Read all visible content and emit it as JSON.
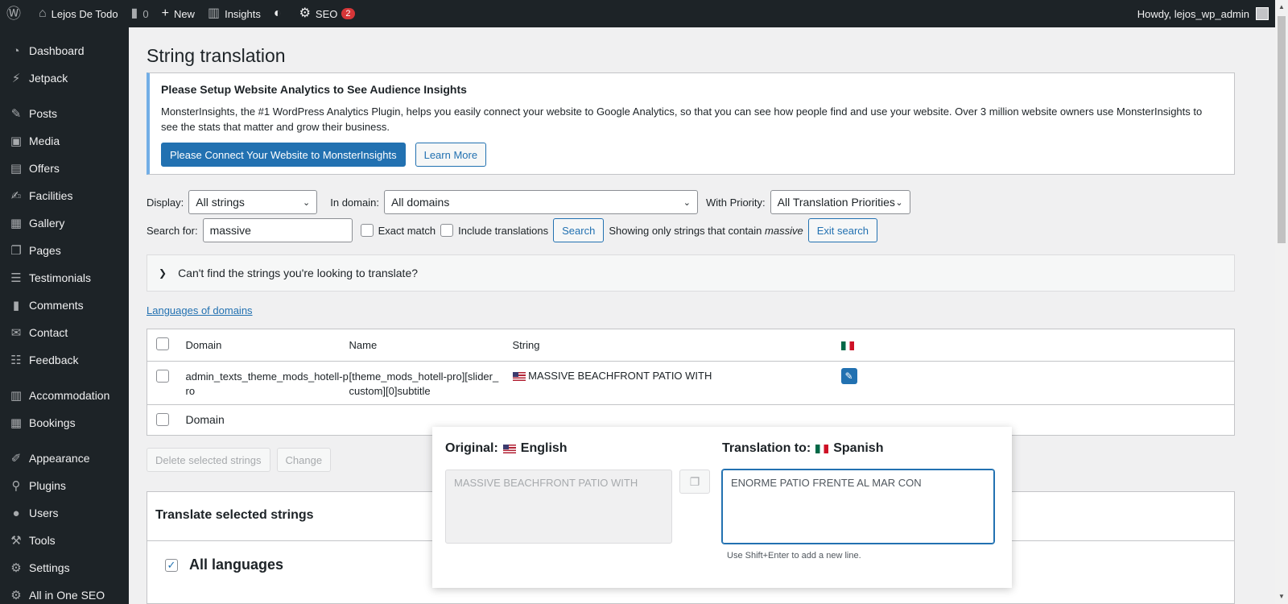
{
  "adminbar": {
    "site_name": "Lejos De Todo",
    "comments_count": "0",
    "new_label": "New",
    "insights_label": "Insights",
    "seo_label": "SEO",
    "seo_badge": "2",
    "howdy": "Howdy, lejos_wp_admin"
  },
  "sidebar": {
    "items": [
      {
        "label": "Dashboard",
        "icon": "dashboard-icon"
      },
      {
        "label": "Jetpack",
        "icon": "jetpack-icon"
      },
      {
        "label": "Posts",
        "icon": "pin-icon"
      },
      {
        "label": "Media",
        "icon": "media-icon"
      },
      {
        "label": "Offers",
        "icon": "briefcase-icon"
      },
      {
        "label": "Facilities",
        "icon": "edit-page-icon"
      },
      {
        "label": "Gallery",
        "icon": "gallery-icon"
      },
      {
        "label": "Pages",
        "icon": "pages-icon"
      },
      {
        "label": "Testimonials",
        "icon": "testimonial-icon"
      },
      {
        "label": "Comments",
        "icon": "comment-icon"
      },
      {
        "label": "Contact",
        "icon": "mail-icon"
      },
      {
        "label": "Feedback",
        "icon": "feedback-icon"
      },
      {
        "label": "Accommodation",
        "icon": "building-icon"
      },
      {
        "label": "Bookings",
        "icon": "calendar-icon"
      },
      {
        "label": "Appearance",
        "icon": "brush-icon"
      },
      {
        "label": "Plugins",
        "icon": "plugin-icon"
      },
      {
        "label": "Users",
        "icon": "user-icon"
      },
      {
        "label": "Tools",
        "icon": "wrench-icon"
      },
      {
        "label": "Settings",
        "icon": "settings-icon"
      },
      {
        "label": "All in One SEO",
        "icon": "seo-icon"
      }
    ]
  },
  "page": {
    "title": "String translation"
  },
  "notice": {
    "title": "Please Setup Website Analytics to See Audience Insights",
    "text": "MonsterInsights, the #1 WordPress Analytics Plugin, helps you easily connect your website to Google Analytics, so that you can see how people find and use your website. Over 3 million website owners use MonsterInsights to see the stats that matter and grow their business.",
    "connect_button": "Please Connect Your Website to MonsterInsights",
    "learn_button": "Learn More"
  },
  "filters": {
    "display_label": "Display:",
    "display_value": "All strings",
    "domain_label": "In domain:",
    "domain_value": "All domains",
    "priority_label": "With Priority:",
    "priority_value": "All Translation Priorities",
    "search_label": "Search for:",
    "search_value": "massive",
    "exact_match": "Exact match",
    "include_translations": "Include translations",
    "search_button": "Search",
    "showing_prefix": "Showing only strings that contain",
    "showing_term": "massive",
    "exit_button": "Exit search"
  },
  "accordion": {
    "label": "Can't find the strings you're looking to translate?"
  },
  "languages_link": "Languages of domains",
  "table": {
    "headers": {
      "domain": "Domain",
      "name": "Name",
      "string": "String"
    },
    "rows": [
      {
        "domain": "admin_texts_theme_mods_hotell-pro",
        "name": "[theme_mods_hotell-pro][slider_custom][0]subtitle",
        "string": "MASSIVE BEACHFRONT PATIO WITH"
      }
    ],
    "footer_domain": "Domain"
  },
  "bulk": {
    "delete_button": "Delete selected strings",
    "change_button": "Change"
  },
  "translate_box": {
    "title": "Translate selected strings",
    "all_languages": "All languages"
  },
  "popup": {
    "original_label": "Original:",
    "original_lang": "English",
    "original_text": "MASSIVE BEACHFRONT PATIO WITH",
    "translation_label": "Translation to:",
    "translation_lang": "Spanish",
    "translation_text": "ENORME PATIO FRENTE AL MAR CON",
    "hint": "Use Shift+Enter to add a new line."
  },
  "colors": {
    "accent": "#2271b1",
    "adminbar": "#1d2327",
    "notice_border": "#72aee6",
    "badge": "#d63638"
  }
}
